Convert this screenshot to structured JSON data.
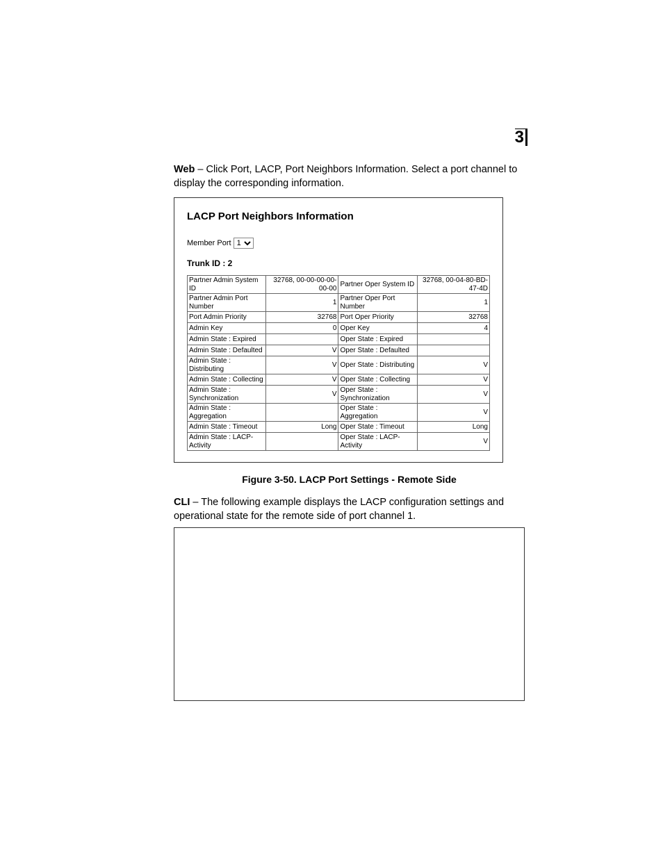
{
  "header": {
    "chapter": "3"
  },
  "web_para": {
    "bold": "Web",
    "text": " – Click Port, LACP, Port Neighbors Information. Select a port channel to display the corresponding information."
  },
  "screenshot": {
    "title": "LACP Port Neighbors Information",
    "memberport_label": "Member Port",
    "memberport_value": "1",
    "trunkid_label": "Trunk ID : 2",
    "rows": [
      {
        "l": "Partner Admin System ID",
        "lv": "32768, 00-00-00-00-00-00",
        "r": "Partner Oper System ID",
        "rv": "32768, 00-04-80-BD-47-4D"
      },
      {
        "l": "Partner Admin Port Number",
        "lv": "1",
        "r": "Partner Oper Port Number",
        "rv": "1"
      },
      {
        "l": "Port Admin Priority",
        "lv": "32768",
        "r": "Port Oper Priority",
        "rv": "32768"
      },
      {
        "l": "Admin Key",
        "lv": "0",
        "r": "Oper Key",
        "rv": "4"
      },
      {
        "l": "Admin State : Expired",
        "lv": "",
        "r": "Oper State : Expired",
        "rv": ""
      },
      {
        "l": "Admin State : Defaulted",
        "lv": "V",
        "r": "Oper State : Defaulted",
        "rv": ""
      },
      {
        "l": "Admin State : Distributing",
        "lv": "V",
        "r": "Oper State : Distributing",
        "rv": "V"
      },
      {
        "l": "Admin State : Collecting",
        "lv": "V",
        "r": "Oper State : Collecting",
        "rv": "V"
      },
      {
        "l": "Admin State : Synchronization",
        "lv": "V",
        "r": "Oper State : Synchronization",
        "rv": "V"
      },
      {
        "l": "Admin State : Aggregation",
        "lv": "",
        "r": "Oper State : Aggregation",
        "rv": "V"
      },
      {
        "l": "Admin State : Timeout",
        "lv": "Long",
        "r": "Oper State : Timeout",
        "rv": "Long"
      },
      {
        "l": "Admin State : LACP-Activity",
        "lv": "",
        "r": "Oper State : LACP-Activity",
        "rv": "V"
      }
    ]
  },
  "figure_caption": "Figure 3-50.  LACP Port Settings - Remote Side",
  "cli_para": {
    "bold": "CLI",
    "text": " – The following example displays the LACP configuration settings and operational state for the remote side of port channel 1."
  }
}
